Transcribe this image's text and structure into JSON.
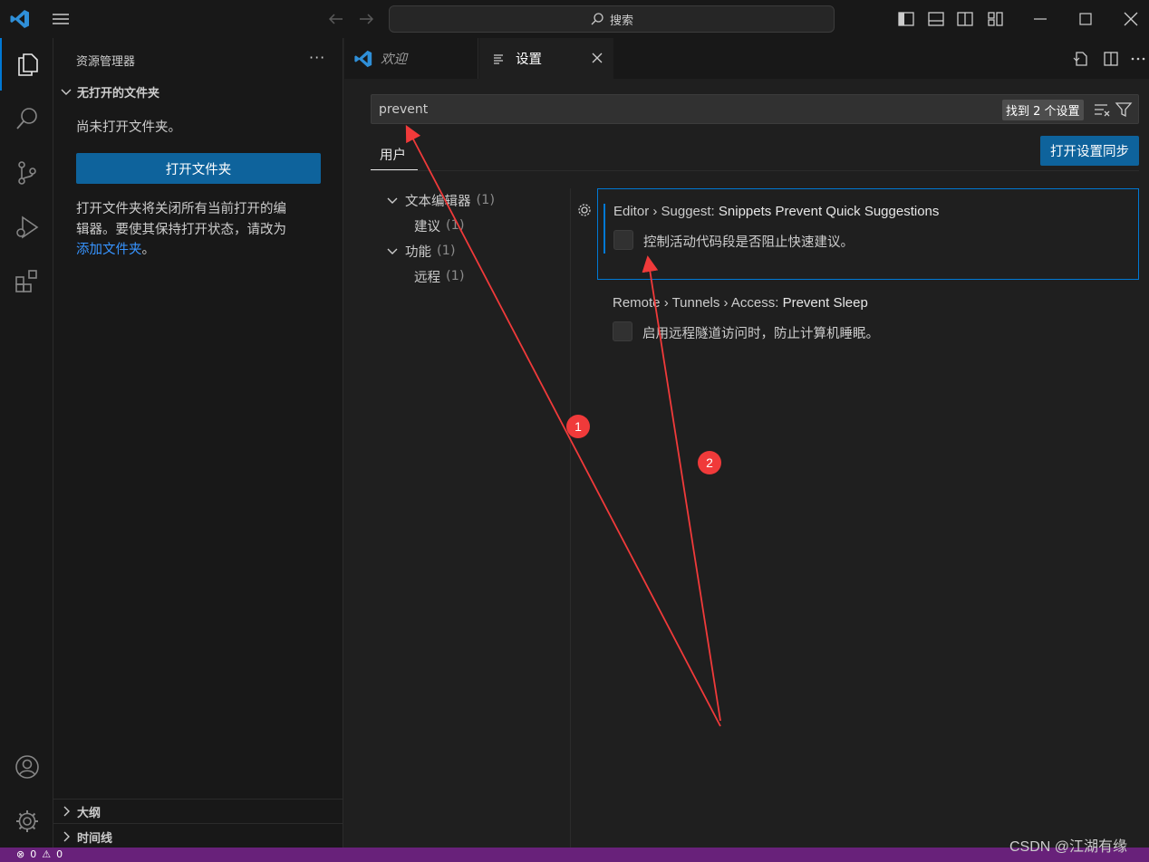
{
  "titlebar": {
    "search_label": "搜索"
  },
  "sidebar": {
    "header": "资源管理器",
    "more": "···",
    "section_title": "无打开的文件夹",
    "no_folder_text": "尚未打开文件夹。",
    "open_folder_button": "打开文件夹",
    "info_line1": "打开文件夹将关闭所有当前打开的编",
    "info_line2": "辑器。要使其保持打开状态，请改为",
    "add_folder_link": "添加文件夹",
    "info_end": "。",
    "outline": "大纲",
    "timeline": "时间线"
  },
  "tabs": {
    "welcome": "欢迎",
    "settings": "设置"
  },
  "settings": {
    "search_value": "prevent",
    "result_count": "找到 2 个设置",
    "scope_tab": "用户",
    "sync_button": "打开设置同步",
    "toc": [
      {
        "label": "文本编辑器",
        "count": "(1)"
      },
      {
        "label": "建议",
        "count": "(1)"
      },
      {
        "label": "功能",
        "count": "(1)"
      },
      {
        "label": "远程",
        "count": "(1)"
      }
    ],
    "items": [
      {
        "category": "Editor › Suggest: ",
        "name": "Snippets Prevent Quick Suggestions",
        "description": "控制活动代码段是否阻止快速建议。",
        "checked": false
      },
      {
        "category": "Remote › Tunnels › Access: ",
        "name": "Prevent Sleep",
        "description": "启用远程隧道访问时，防止计算机睡眠。",
        "checked": false
      }
    ]
  },
  "statusbar": {
    "errors": "0",
    "warnings": "0"
  },
  "annotations": {
    "badge1": "1",
    "badge2": "2",
    "color": "#f03a3a"
  },
  "watermark": "CSDN @江湖有缘",
  "colors": {
    "accent": "#0078d4",
    "button": "#0e639c",
    "statusbar": "#68217a"
  }
}
